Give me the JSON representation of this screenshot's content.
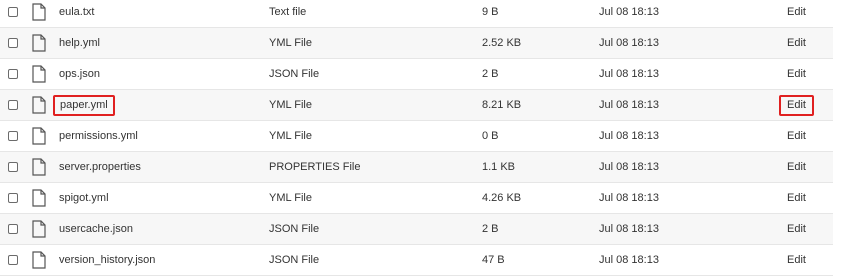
{
  "files": [
    {
      "name": "eula.txt",
      "type": "Text file",
      "size": "9 B",
      "date": "Jul 08 18:13",
      "action": "Edit"
    },
    {
      "name": "help.yml",
      "type": "YML File",
      "size": "2.52 KB",
      "date": "Jul 08 18:13",
      "action": "Edit"
    },
    {
      "name": "ops.json",
      "type": "JSON File",
      "size": "2 B",
      "date": "Jul 08 18:13",
      "action": "Edit"
    },
    {
      "name": "paper.yml",
      "type": "YML File",
      "size": "8.21 KB",
      "date": "Jul 08 18:13",
      "action": "Edit"
    },
    {
      "name": "permissions.yml",
      "type": "YML File",
      "size": "0 B",
      "date": "Jul 08 18:13",
      "action": "Edit"
    },
    {
      "name": "server.properties",
      "type": "PROPERTIES File",
      "size": "1.1 KB",
      "date": "Jul 08 18:13",
      "action": "Edit"
    },
    {
      "name": "spigot.yml",
      "type": "YML File",
      "size": "4.26 KB",
      "date": "Jul 08 18:13",
      "action": "Edit"
    },
    {
      "name": "usercache.json",
      "type": "JSON File",
      "size": "2 B",
      "date": "Jul 08 18:13",
      "action": "Edit"
    },
    {
      "name": "version_history.json",
      "type": "JSON File",
      "size": "47 B",
      "date": "Jul 08 18:13",
      "action": "Edit"
    }
  ],
  "icons": {
    "file": "file-icon"
  },
  "colors": {
    "highlight": "#e02020",
    "row_alt": "#f7f7f7",
    "text": "#333333"
  }
}
